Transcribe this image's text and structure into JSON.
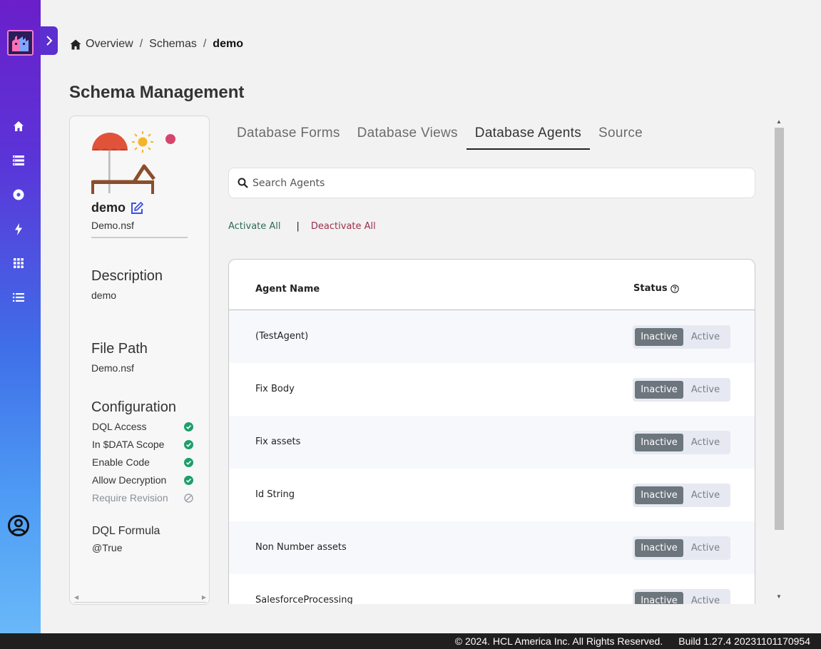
{
  "breadcrumb": {
    "items": [
      "Overview",
      "Schemas"
    ],
    "current": "demo",
    "separator": "/"
  },
  "page": {
    "title": "Schema Management"
  },
  "schema": {
    "name": "demo",
    "file": "Demo.nsf",
    "description_heading": "Description",
    "description": "demo",
    "file_path_heading": "File Path",
    "file_path": "Demo.nsf",
    "configuration_heading": "Configuration",
    "configuration": [
      {
        "label": "DQL Access",
        "enabled": true
      },
      {
        "label": "In $DATA Scope",
        "enabled": true
      },
      {
        "label": "Enable Code",
        "enabled": true
      },
      {
        "label": "Allow Decryption",
        "enabled": true
      },
      {
        "label": "Require Revision",
        "enabled": false
      }
    ],
    "dql_heading": "DQL Formula",
    "dql_formula": "@True"
  },
  "tabs": [
    "Database Forms",
    "Database Views",
    "Database Agents",
    "Source"
  ],
  "active_tab": "Database Agents",
  "search": {
    "placeholder": "Search Agents",
    "value": ""
  },
  "actions": {
    "activate_all": "Activate All",
    "separator": "|",
    "deactivate_all": "Deactivate All"
  },
  "table": {
    "columns": {
      "name": "Agent Name",
      "status": "Status"
    },
    "toggle_labels": {
      "inactive": "Inactive",
      "active": "Active"
    },
    "rows": [
      {
        "name": "(TestAgent)",
        "status": "Inactive"
      },
      {
        "name": "Fix Body",
        "status": "Inactive"
      },
      {
        "name": "Fix assets",
        "status": "Inactive"
      },
      {
        "name": "Id String",
        "status": "Inactive"
      },
      {
        "name": "Non Number assets",
        "status": "Inactive"
      },
      {
        "name": "SalesforceProcessing",
        "status": "Inactive"
      }
    ]
  },
  "footer": {
    "copyright": "© 2024. HCL America Inc. All Rights Reserved.",
    "build": "Build 1.27.4 20231101170954"
  },
  "colors": {
    "sidebar_top": "#6a1fc9",
    "sidebar_bottom": "#6ab8f8",
    "check_green": "#1e9e6a",
    "activate_green": "#2e6b56",
    "deactivate_red": "#9a2f4c",
    "toggle_selected": "#6d757d"
  },
  "icons": {
    "sidebar": [
      "home-icon",
      "list-icon",
      "disc-icon",
      "bolt-icon",
      "grid-icon",
      "menu-list-icon"
    ],
    "user": "user-circle-icon"
  }
}
